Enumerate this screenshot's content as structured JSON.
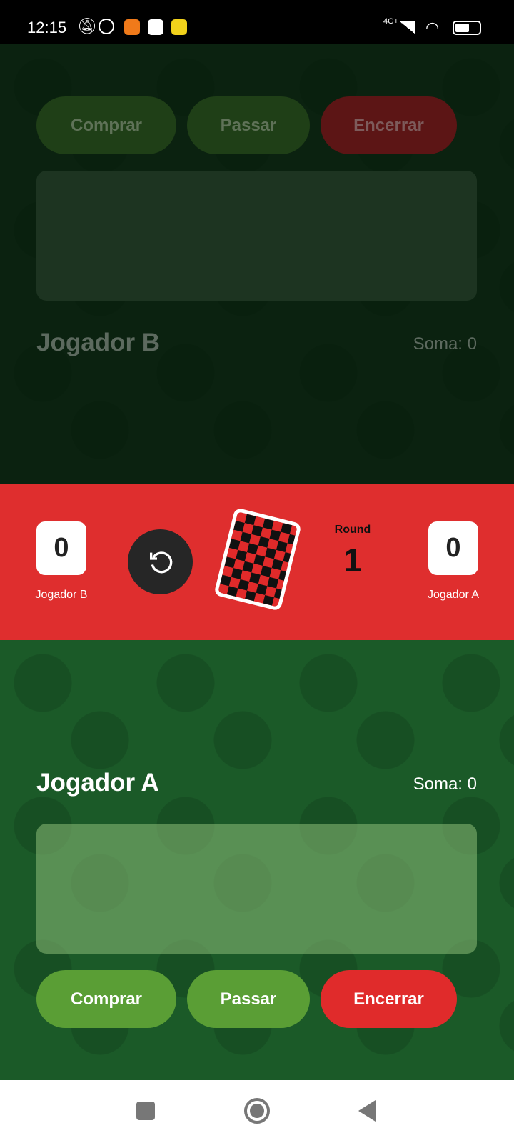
{
  "status_bar": {
    "time": "12:15",
    "network": "4G+"
  },
  "player_b": {
    "name": "Jogador B",
    "sum_label": "Soma: 0",
    "buttons": {
      "buy": "Comprar",
      "pass": "Passar",
      "end": "Encerrar"
    }
  },
  "player_a": {
    "name": "Jogador A",
    "sum_label": "Soma: 0",
    "buttons": {
      "buy": "Comprar",
      "pass": "Passar",
      "end": "Encerrar"
    }
  },
  "scoreboard": {
    "score_b": "0",
    "label_b": "Jogador B",
    "score_a": "0",
    "label_a": "Jogador A",
    "round_label": "Round",
    "round_value": "1"
  },
  "colors": {
    "green": "#5a9e35",
    "red": "#df2e2e",
    "felt": "#1b5a28"
  }
}
